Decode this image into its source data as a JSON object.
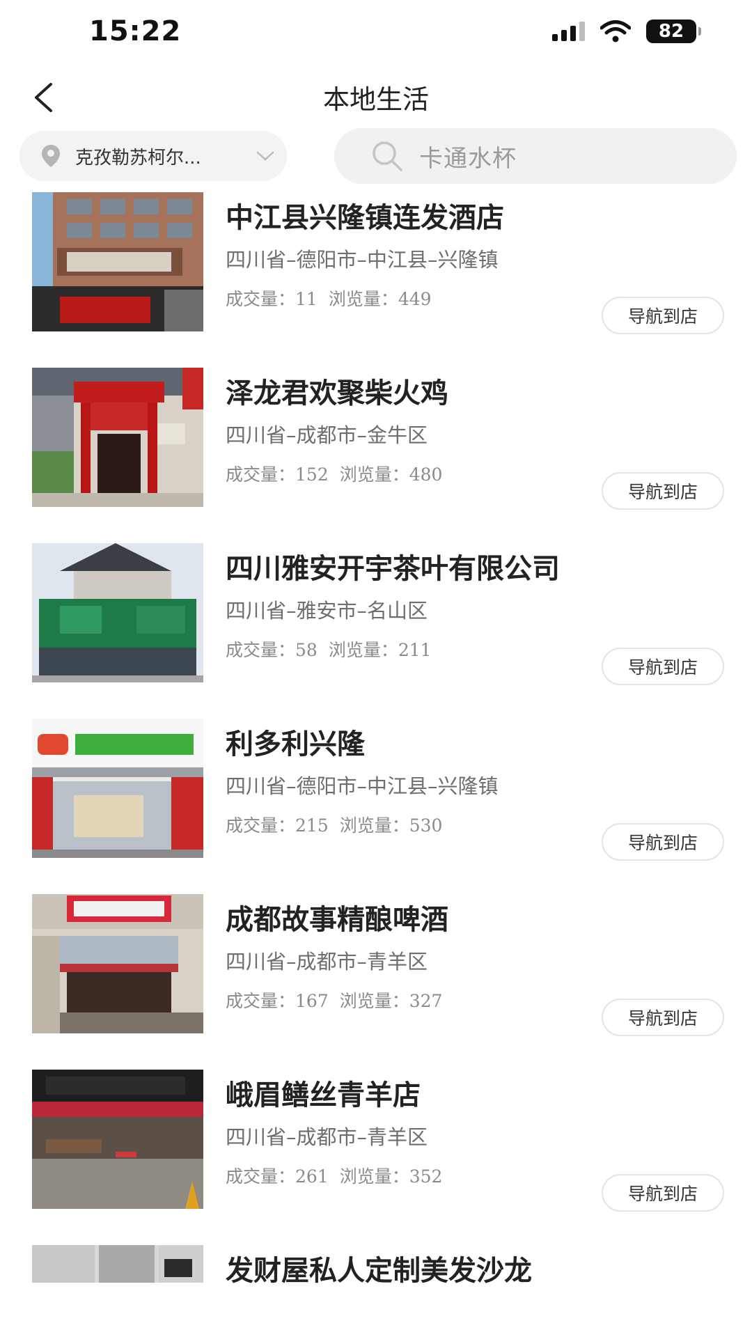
{
  "status_bar": {
    "time": "15:22",
    "battery": "82"
  },
  "header": {
    "title": "本地生活",
    "back_icon": "chevron-left-icon"
  },
  "filters": {
    "location": "克孜勒苏柯尔...",
    "search_placeholder": "卡通水杯"
  },
  "stats_labels": {
    "deals": "成交量：",
    "views": "浏览量："
  },
  "stores": [
    {
      "name": "中江县兴隆镇连发酒店",
      "address": "四川省–德阳市–中江县–兴隆镇",
      "deals": "11",
      "views": "449",
      "button": "导航到店"
    },
    {
      "name": "泽龙君欢聚柴火鸡",
      "address": "四川省–成都市–金牛区",
      "deals": "152",
      "views": "480",
      "button": "导航到店"
    },
    {
      "name": "四川雅安开宇茶叶有限公司",
      "address": "四川省–雅安市–名山区",
      "deals": "58",
      "views": "211",
      "button": "导航到店"
    },
    {
      "name": "利多利兴隆",
      "address": "四川省–德阳市–中江县–兴隆镇",
      "deals": "215",
      "views": "530",
      "button": "导航到店"
    },
    {
      "name": "成都故事精酿啤酒",
      "address": "四川省–成都市–青羊区",
      "deals": "167",
      "views": "327",
      "button": "导航到店"
    },
    {
      "name": "峨眉鳝丝青羊店",
      "address": "四川省–成都市–青羊区",
      "deals": "261",
      "views": "352",
      "button": "导航到店"
    },
    {
      "name": "发财屋私人定制美发沙龙"
    }
  ],
  "colors": {
    "background": "#ffffff",
    "chip_bg": "#f3f3f3",
    "muted_text": "#8a8a8a"
  }
}
